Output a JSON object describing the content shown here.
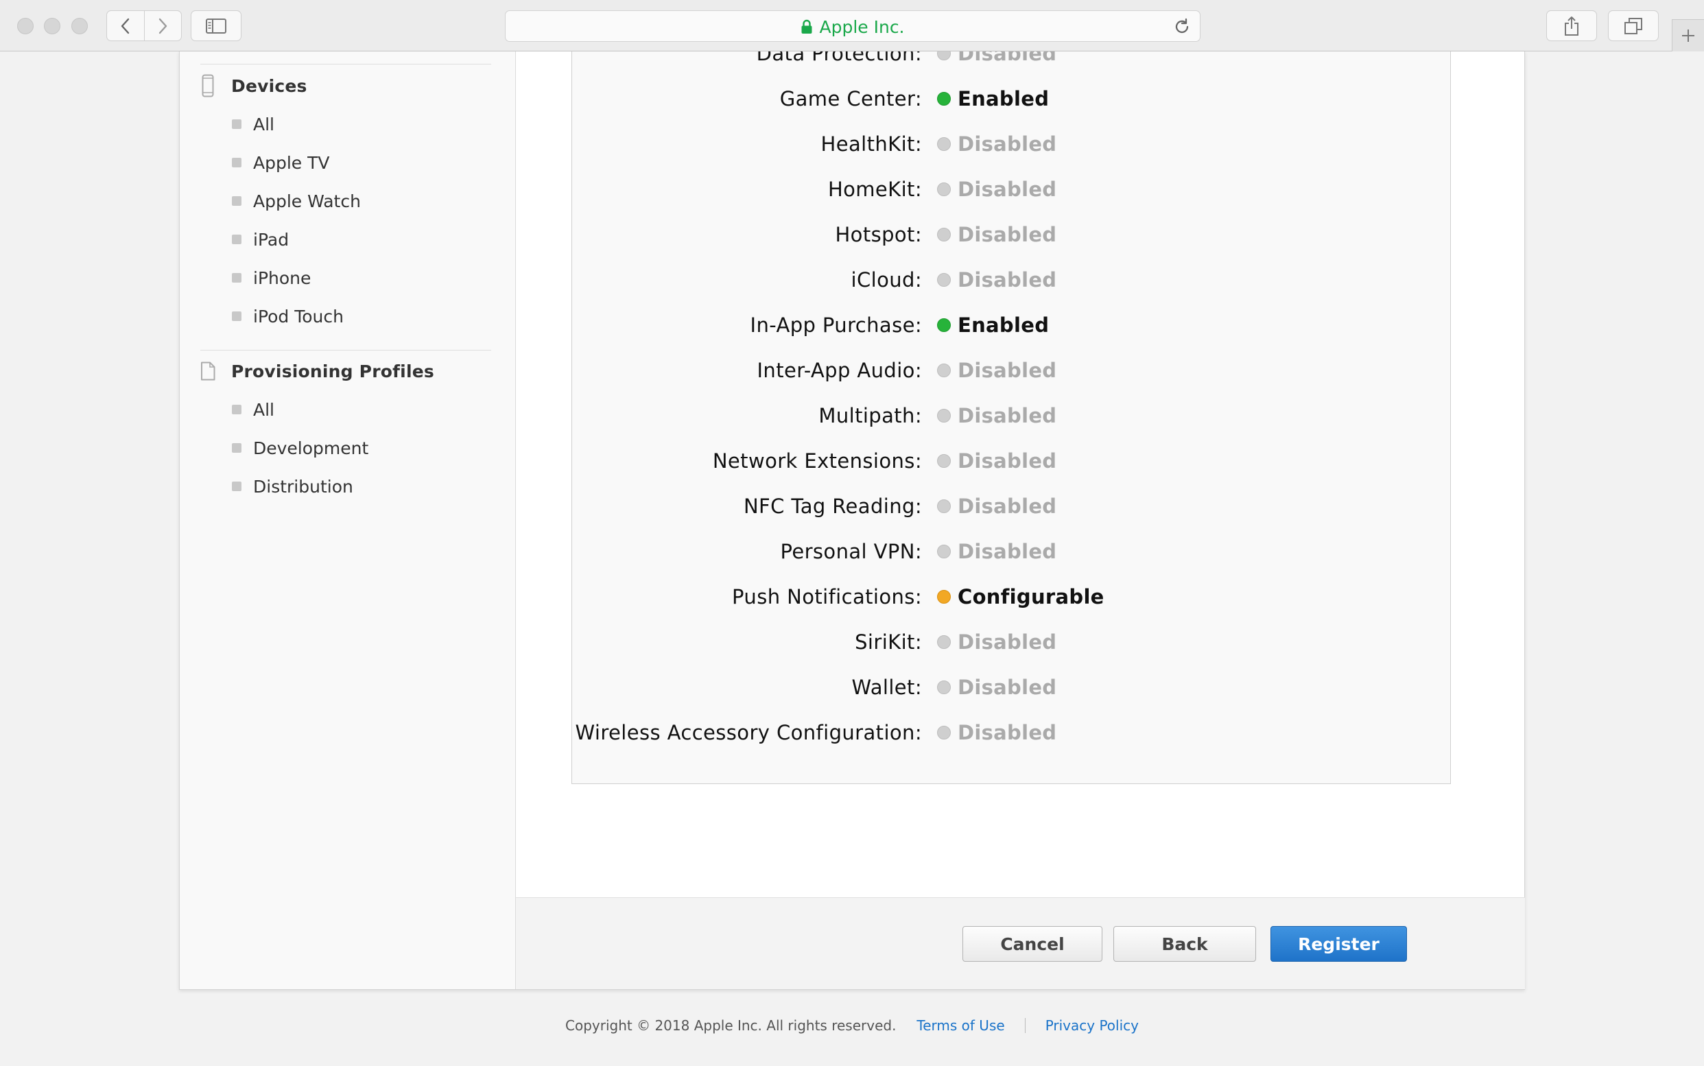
{
  "browser": {
    "address_text": "Apple Inc.",
    "accent_color": "#1aa84a"
  },
  "sidebar": {
    "devices": {
      "title": "Devices",
      "icon": "device-phone-icon",
      "items": [
        "All",
        "Apple TV",
        "Apple Watch",
        "iPad",
        "iPhone",
        "iPod Touch"
      ]
    },
    "profiles": {
      "title": "Provisioning Profiles",
      "icon": "document-icon",
      "items": [
        "All",
        "Development",
        "Distribution"
      ]
    }
  },
  "services": [
    {
      "label": "Data Protection:",
      "status": "Disabled",
      "state": "disabled"
    },
    {
      "label": "Game Center:",
      "status": "Enabled",
      "state": "enabled"
    },
    {
      "label": "HealthKit:",
      "status": "Disabled",
      "state": "disabled"
    },
    {
      "label": "HomeKit:",
      "status": "Disabled",
      "state": "disabled"
    },
    {
      "label": "Hotspot:",
      "status": "Disabled",
      "state": "disabled"
    },
    {
      "label": "iCloud:",
      "status": "Disabled",
      "state": "disabled"
    },
    {
      "label": "In-App Purchase:",
      "status": "Enabled",
      "state": "enabled"
    },
    {
      "label": "Inter-App Audio:",
      "status": "Disabled",
      "state": "disabled"
    },
    {
      "label": "Multipath:",
      "status": "Disabled",
      "state": "disabled"
    },
    {
      "label": "Network Extensions:",
      "status": "Disabled",
      "state": "disabled"
    },
    {
      "label": "NFC Tag Reading:",
      "status": "Disabled",
      "state": "disabled"
    },
    {
      "label": "Personal VPN:",
      "status": "Disabled",
      "state": "disabled"
    },
    {
      "label": "Push Notifications:",
      "status": "Configurable",
      "state": "configurable"
    },
    {
      "label": "SiriKit:",
      "status": "Disabled",
      "state": "disabled"
    },
    {
      "label": "Wallet:",
      "status": "Disabled",
      "state": "disabled"
    },
    {
      "label": "Wireless Accessory Configuration:",
      "status": "Disabled",
      "state": "disabled"
    }
  ],
  "status_colors": {
    "enabled": "#27b33a",
    "disabled": "#cfcfcf",
    "configurable": "#f2a825"
  },
  "actions": {
    "cancel_label": "Cancel",
    "back_label": "Back",
    "register_label": "Register"
  },
  "footer": {
    "copyright": "Copyright © 2018 Apple Inc. All rights reserved.",
    "terms_label": "Terms of Use",
    "privacy_label": "Privacy Policy"
  }
}
